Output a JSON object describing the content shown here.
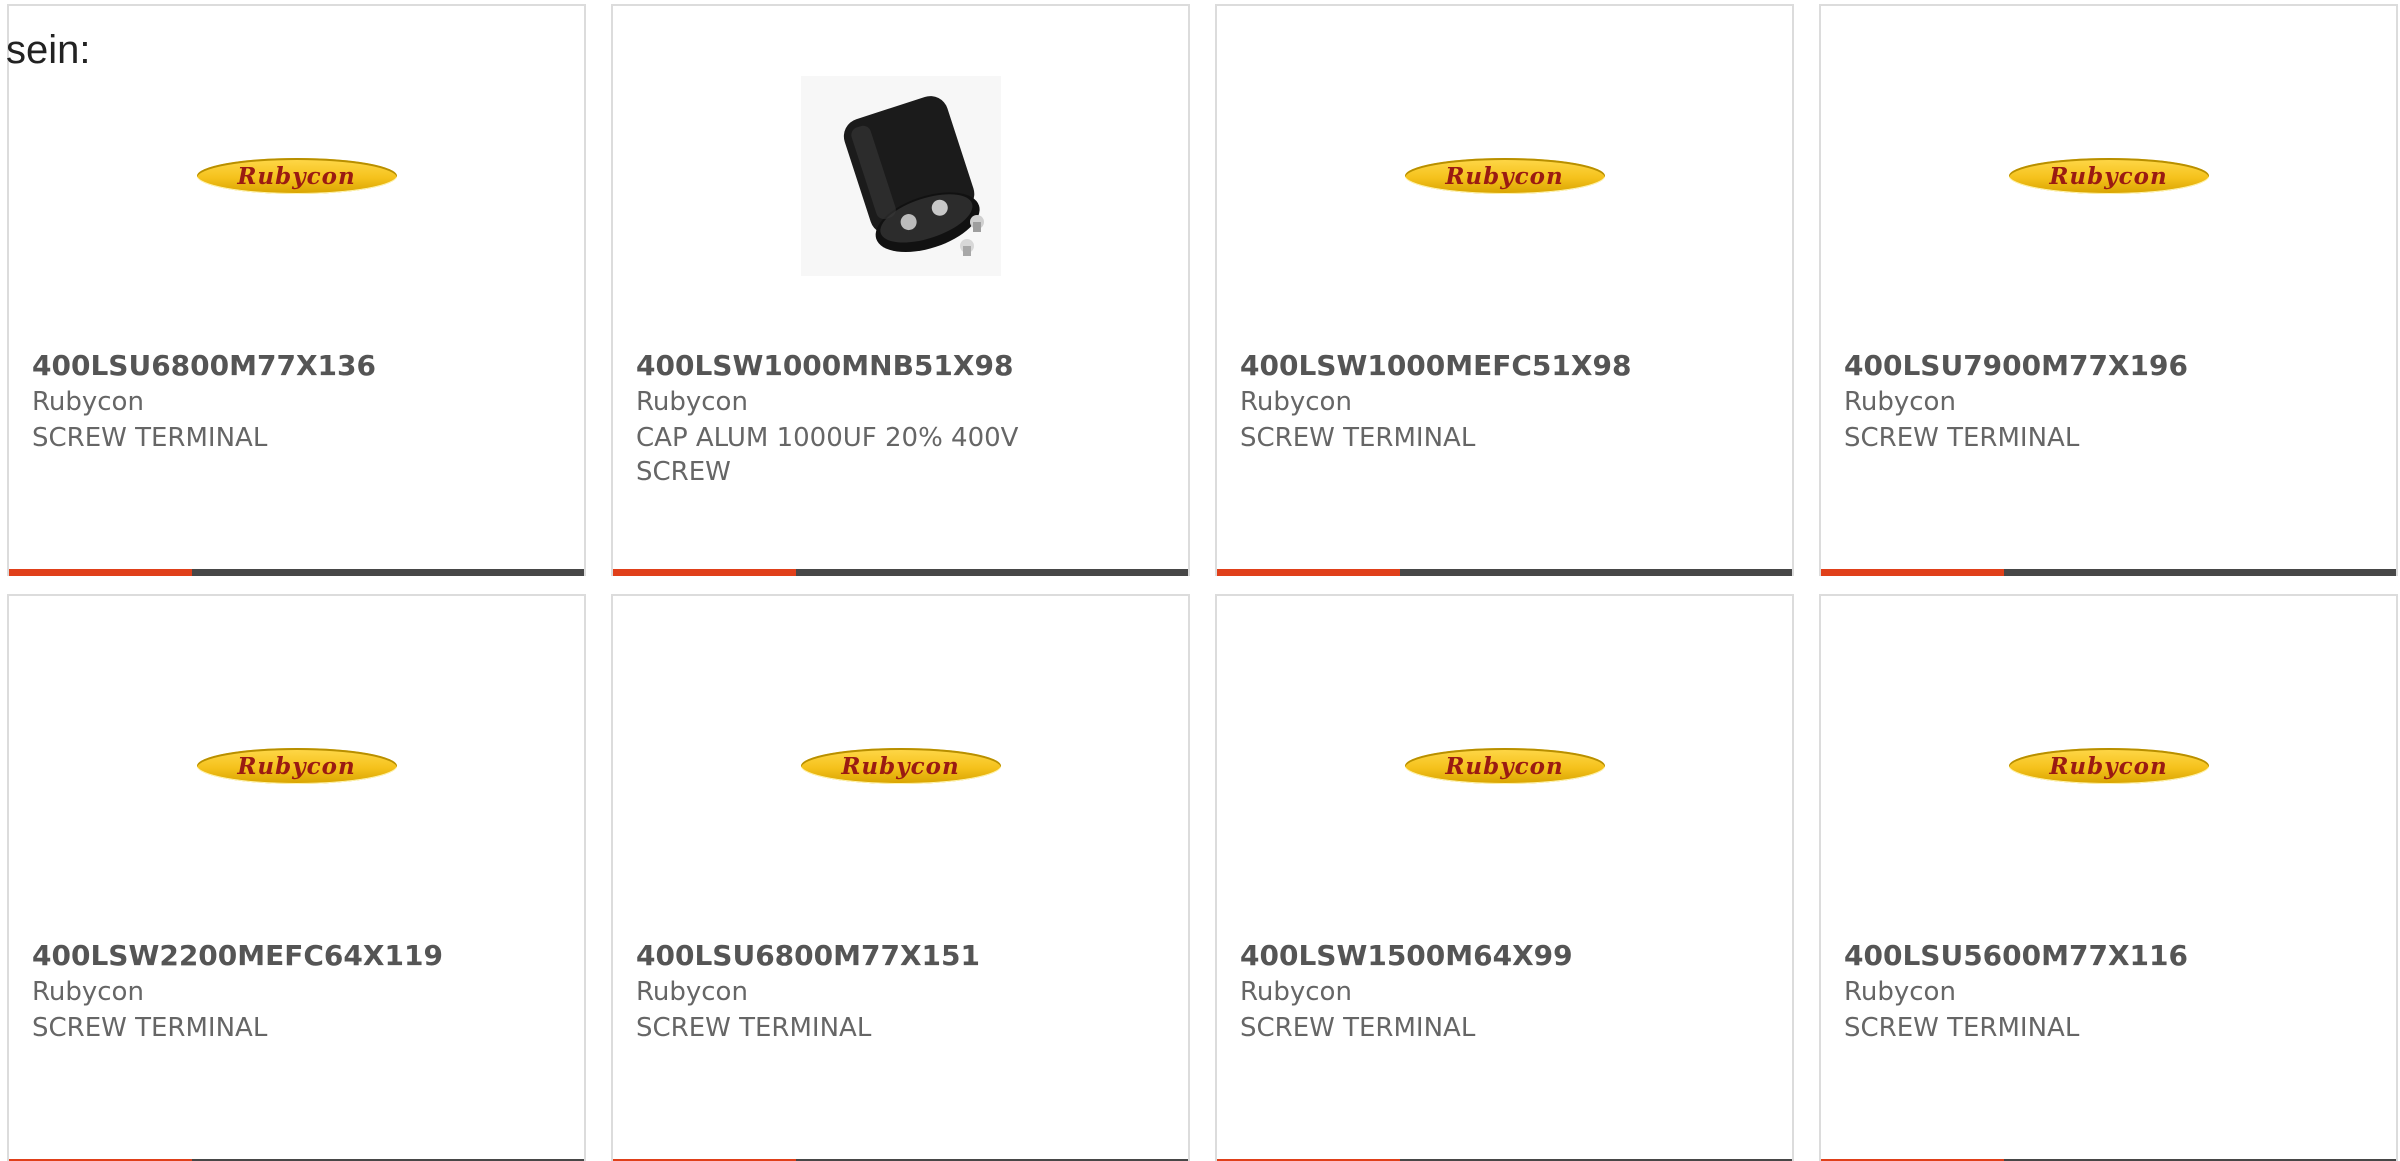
{
  "intro_text": "sein:",
  "accent_color": "#e0401a",
  "bar_color": "#474747",
  "cards": [
    {
      "part": "400LSU6800M77X136",
      "mfr": "Rubycon",
      "desc": "SCREW TERMINAL",
      "image": "rubycon-logo",
      "logo_text": "Rubycon"
    },
    {
      "part": "400LSW1000MNB51X98",
      "mfr": "Rubycon",
      "desc": "CAP ALUM 1000UF 20% 400V SCREW",
      "image": "capacitor-photo",
      "logo_text": ""
    },
    {
      "part": "400LSW1000MEFC51X98",
      "mfr": "Rubycon",
      "desc": "SCREW TERMINAL",
      "image": "rubycon-logo",
      "logo_text": "Rubycon"
    },
    {
      "part": "400LSU7900M77X196",
      "mfr": "Rubycon",
      "desc": "SCREW TERMINAL",
      "image": "rubycon-logo",
      "logo_text": "Rubycon"
    },
    {
      "part": "400LSW2200MEFC64X119",
      "mfr": "Rubycon",
      "desc": "SCREW TERMINAL",
      "image": "rubycon-logo",
      "logo_text": "Rubycon"
    },
    {
      "part": "400LSU6800M77X151",
      "mfr": "Rubycon",
      "desc": "SCREW TERMINAL",
      "image": "rubycon-logo",
      "logo_text": "Rubycon"
    },
    {
      "part": "400LSW1500M64X99",
      "mfr": "Rubycon",
      "desc": "SCREW TERMINAL",
      "image": "rubycon-logo",
      "logo_text": "Rubycon"
    },
    {
      "part": "400LSU5600M77X116",
      "mfr": "Rubycon",
      "desc": "SCREW TERMINAL",
      "image": "rubycon-logo",
      "logo_text": "Rubycon"
    }
  ]
}
